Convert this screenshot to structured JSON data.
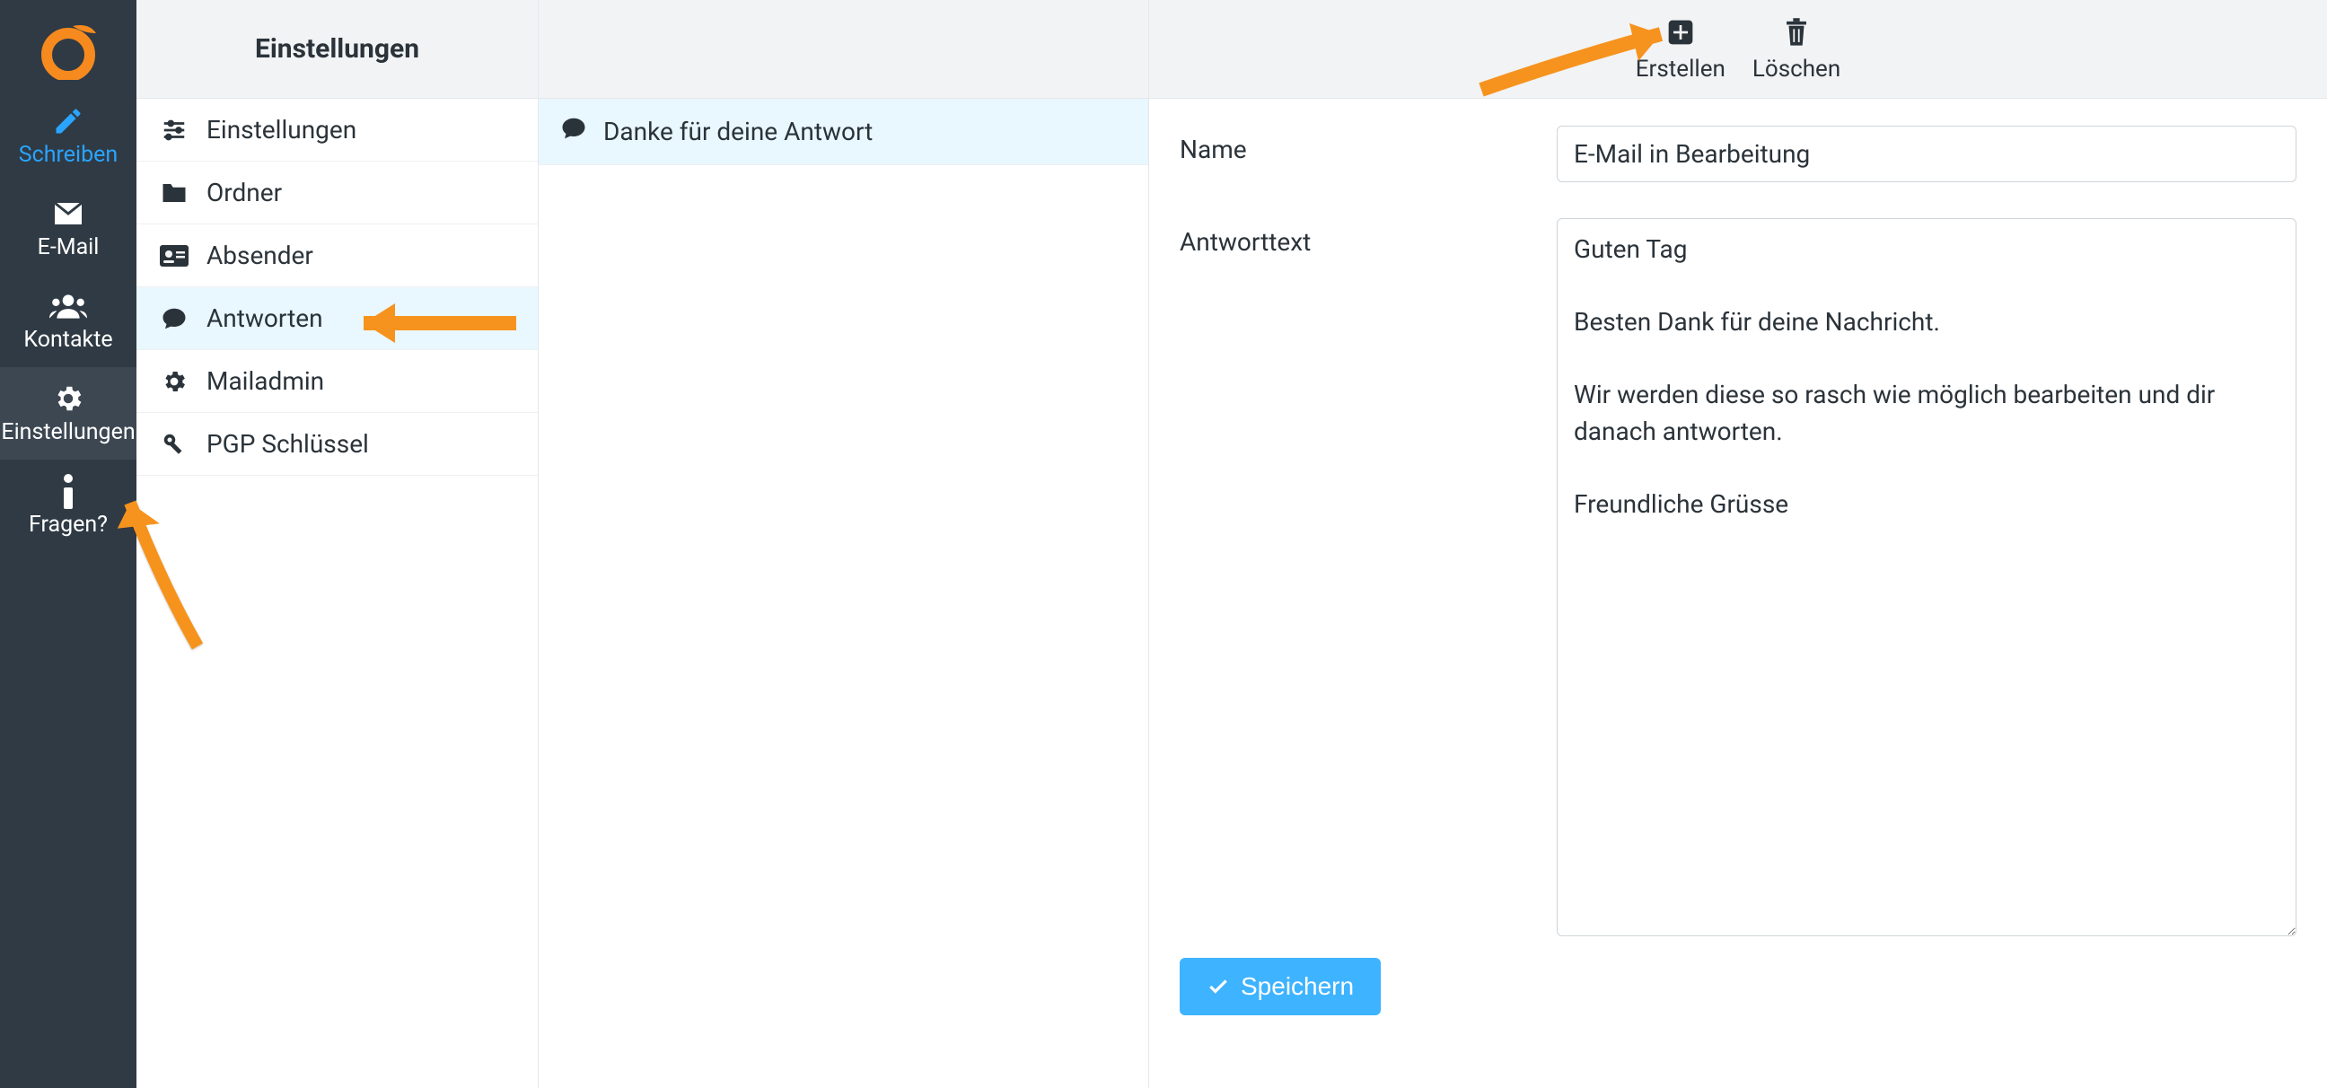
{
  "sidebar": {
    "items": [
      {
        "label": "Schreiben"
      },
      {
        "label": "E-Mail"
      },
      {
        "label": "Kontakte"
      },
      {
        "label": "Einstellungen"
      },
      {
        "label": "Fragen?"
      }
    ]
  },
  "settings": {
    "header": "Einstellungen",
    "items": [
      {
        "label": "Einstellungen"
      },
      {
        "label": "Ordner"
      },
      {
        "label": "Absender"
      },
      {
        "label": "Antworten"
      },
      {
        "label": "Mailadmin"
      },
      {
        "label": "PGP Schlüssel"
      }
    ]
  },
  "responses": {
    "items": [
      {
        "label": "Danke für deine Antwort"
      }
    ]
  },
  "toolbar": {
    "create_label": "Erstellen",
    "delete_label": "Löschen"
  },
  "form": {
    "name_label": "Name",
    "name_value": "E-Mail in Bearbeitung",
    "body_label": "Antworttext",
    "body_value": "Guten Tag\n\nBesten Dank für deine Nachricht.\n\nWir werden diese so rasch wie möglich bearbeiten und dir danach antworten.\n\nFreundliche Grüsse",
    "save_label": "Speichern"
  }
}
